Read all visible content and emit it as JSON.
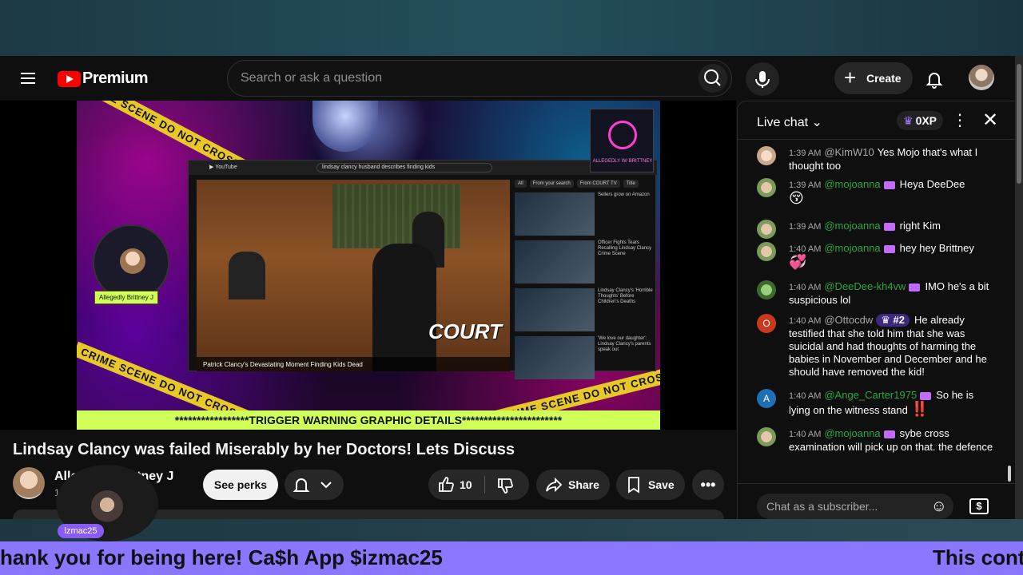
{
  "header": {
    "logo_text": "Premium",
    "search_placeholder": "Search or ask a question",
    "create_label": "Create"
  },
  "player": {
    "tapes": [
      "CRIME SCENE DO NOT CROSS",
      "CRIME SCENE DO NOT CROSS",
      "CRIME SCENE DO NOT CROSS"
    ],
    "inner_search": "lindsay clancy husband describes finding kids",
    "inner_caption": "Patrick Clancy's Devastating Moment Finding Kids Dead",
    "court_logo": "COURT",
    "podcast_text": "ALLEGEDLY W/ BRITTNEY",
    "host_tag": "Allegedly Brittney J",
    "warning": "*****************TRIGGER WARNING GRAPHIC DETAILS***********************",
    "inner_chips": [
      "All",
      "From your search",
      "From COURT TV",
      "Title"
    ],
    "inner_side": [
      "Sellers grow on Amazon",
      "Officer Fights Tears Recalling Lindsay Clancy Crime Scene",
      "Lindsay Clancy's 'Horrible Thoughts' Before Children's Deaths",
      "'We love our daughter': Lindsay Clancy's parents speak out"
    ]
  },
  "video": {
    "title": "Lindsay Clancy was failed Miserably by her Doctors! Lets Discuss",
    "channel_name": "Allegedly Brittney J",
    "channel_subs": "1",
    "perks_label": "See perks",
    "likes": "10",
    "share_label": "Share",
    "save_label": "Save"
  },
  "chat": {
    "title": "Live chat",
    "xp": "0XP",
    "input_placeholder": "Chat as a subscriber...",
    "messages": [
      {
        "time": "1:39 AM",
        "author": "@KimW10",
        "text": "Yes Mojo that's what I thought too",
        "member": false
      },
      {
        "time": "1:39 AM",
        "author": "@mojoanna",
        "text": "Heya DeeDee",
        "emoji": "😚",
        "member": true
      },
      {
        "time": "1:39 AM",
        "author": "@mojoanna",
        "text": "right Kim",
        "member": true
      },
      {
        "time": "1:40 AM",
        "author": "@mojoanna",
        "text": "hey hey Brittney",
        "emoji": "💞",
        "member": true
      },
      {
        "time": "1:40 AM",
        "author": "@DeeDee-kh4vw",
        "text": "IMO he's a bit suspicious lol",
        "member": true
      },
      {
        "time": "1:40 AM",
        "author": "@Ottocdw",
        "rank": "#2",
        "text": "He already testified that she told him that she was suicidal and had thoughts of harming the babies in November and December and he should have removed the kid!",
        "member": false,
        "initial": "O"
      },
      {
        "time": "1:40 AM",
        "author": "@Ange_Carter1975",
        "text": "So he is lying on the witness stand",
        "emoji": "‼️",
        "member": true,
        "initial": "A"
      },
      {
        "time": "1:40 AM",
        "author": "@mojoanna",
        "text": "sybe cross examination will pick up on that. the defence",
        "member": true
      }
    ]
  },
  "overlay": {
    "cam_tag": "lzmac25",
    "ticker_left": "hank you for being here! Ca$h App $izmac25",
    "ticker_right": "This conte"
  },
  "colors": {
    "brand_red": "#ff0000",
    "member_green": "#2ba640",
    "ticker_bg": "#8a76ff",
    "warning_bg": "#cfff58"
  }
}
